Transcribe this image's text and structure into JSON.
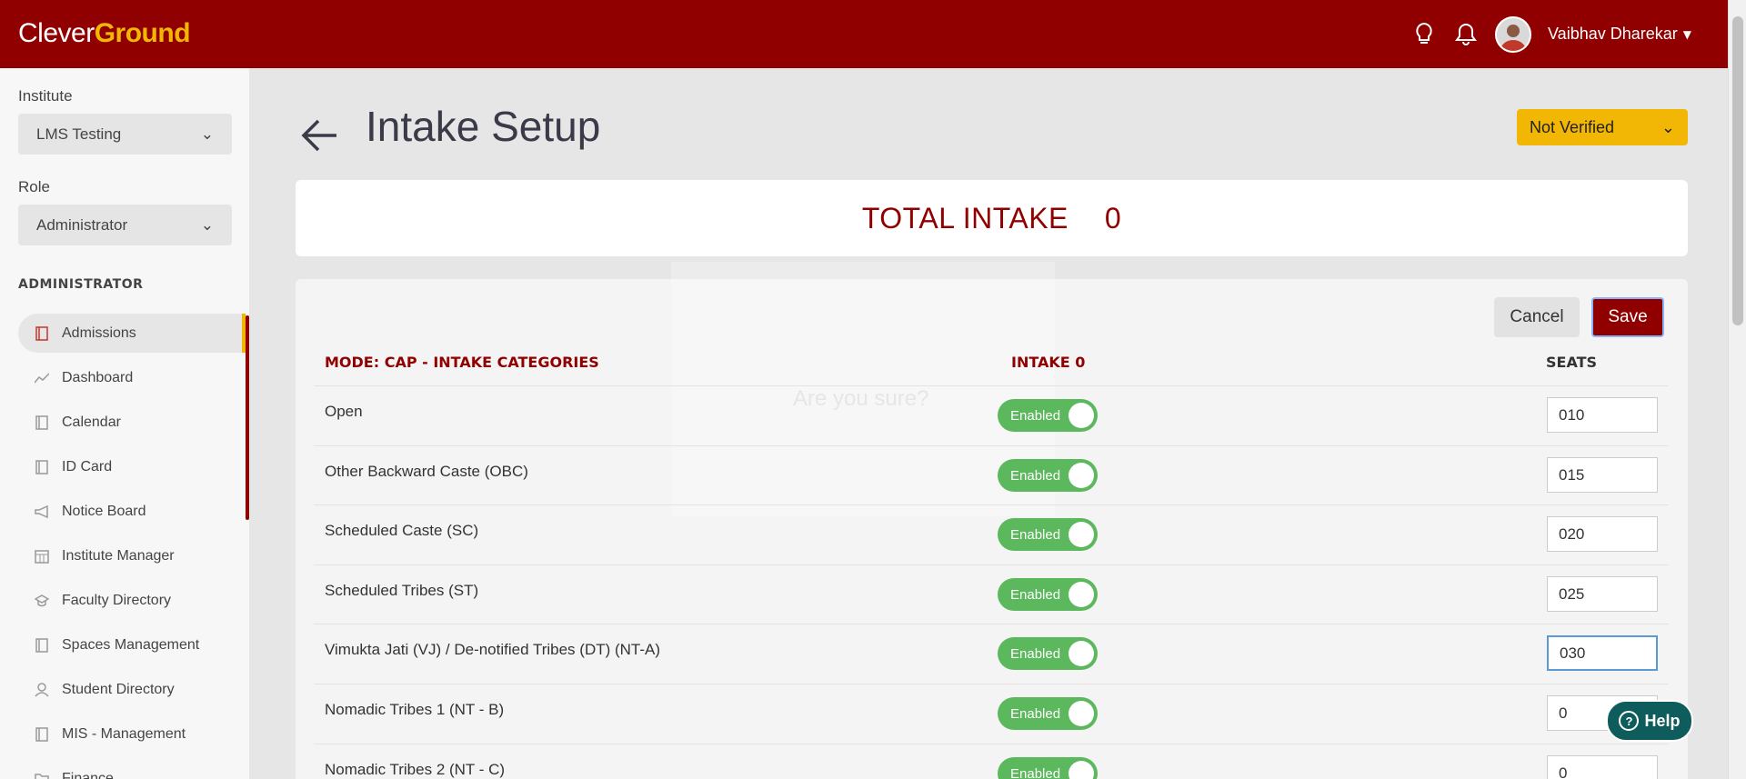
{
  "app": {
    "logo_part1": "Clever",
    "logo_part2": "Ground"
  },
  "header": {
    "user_name": "Vaibhav Dharekar",
    "icons": [
      "lightbulb-icon",
      "bell-icon"
    ]
  },
  "sidebar": {
    "institute_label": "Institute",
    "institute_value": "LMS Testing",
    "role_label": "Role",
    "role_value": "Administrator",
    "section_heading": "ADMINISTRATOR",
    "items": [
      {
        "label": "Admissions",
        "icon": "book-icon",
        "active": true
      },
      {
        "label": "Dashboard",
        "icon": "chart-line-icon"
      },
      {
        "label": "Calendar",
        "icon": "book-icon"
      },
      {
        "label": "ID Card",
        "icon": "book-icon"
      },
      {
        "label": "Notice Board",
        "icon": "megaphone-icon"
      },
      {
        "label": "Institute Manager",
        "icon": "calendar-grid-icon"
      },
      {
        "label": "Faculty Directory",
        "icon": "graduation-cap-icon"
      },
      {
        "label": "Spaces Management",
        "icon": "book-icon"
      },
      {
        "label": "Student Directory",
        "icon": "user-icon"
      },
      {
        "label": "MIS - Management",
        "icon": "book-icon"
      },
      {
        "label": "Finance",
        "icon": "folder-icon"
      }
    ]
  },
  "main": {
    "title": "Intake Setup",
    "status": "Not Verified",
    "total_label": "TOTAL INTAKE",
    "total_value": "0",
    "cancel_label": "Cancel",
    "save_label": "Save",
    "headers": {
      "mode": "MODE: CAP - INTAKE CATEGORIES",
      "intake": "INTAKE 0",
      "seats": "SEATS"
    },
    "rows": [
      {
        "category": "Open",
        "toggle": "Enabled",
        "seats": "010"
      },
      {
        "category": "Other Backward Caste (OBC)",
        "toggle": "Enabled",
        "seats": "015"
      },
      {
        "category": "Scheduled Caste (SC)",
        "toggle": "Enabled",
        "seats": "020"
      },
      {
        "category": "Scheduled Tribes (ST)",
        "toggle": "Enabled",
        "seats": "025"
      },
      {
        "category": "Vimukta Jati (VJ) / De-notified Tribes (DT) (NT-A)",
        "toggle": "Enabled",
        "seats": "030"
      },
      {
        "category": "Nomadic Tribes 1 (NT - B)",
        "toggle": "Enabled",
        "seats": "0"
      },
      {
        "category": "Nomadic Tribes 2 (NT - C)",
        "toggle": "Enabled",
        "seats": "0"
      }
    ]
  },
  "ghost_modal": {
    "title": "Are you sure?"
  },
  "help": {
    "label": "Help"
  },
  "colors": {
    "brand": "#900000",
    "accent": "#f2b705",
    "toggle_on": "#5cb85c",
    "help": "#0f5c5c"
  }
}
